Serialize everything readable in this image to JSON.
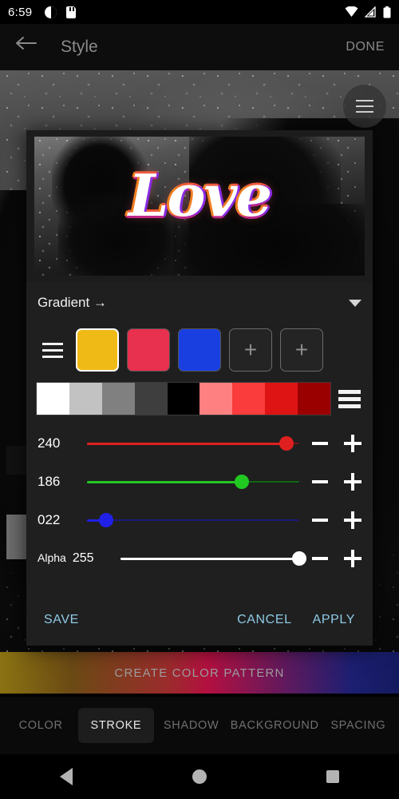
{
  "statusbar": {
    "time": "6:59",
    "icons_left": [
      "do-not-disturb-icon",
      "sd-card-icon"
    ],
    "icons_right": [
      "wifi-icon",
      "cellular-signal-icon",
      "battery-icon"
    ]
  },
  "appbar": {
    "back_icon": "back-arrow-icon",
    "title": "Style",
    "done_label": "DONE"
  },
  "background": {
    "fab_icon": "hamburger-menu-icon"
  },
  "dialog": {
    "preview": {
      "text": "Love"
    },
    "gradient": {
      "label": "Gradient →",
      "caret_icon": "chevron-down-icon"
    },
    "swatches": {
      "handle_icon": "drag-handle-icon",
      "colors": [
        "#F0BA16",
        "#E8304F",
        "#1A3FE0"
      ],
      "selected_index": 0,
      "add_label": "+",
      "add_count": 2
    },
    "palette": {
      "handle_icon": "palette-handle-icon",
      "colors": [
        "#FFFFFF",
        "#C2C2C2",
        "#808080",
        "#3E3E3E",
        "#000000",
        "#FF8080",
        "#FA3C3C",
        "#DE1414",
        "#9B0000"
      ]
    },
    "sliders": [
      {
        "name": "red",
        "value": "240",
        "percent": 94,
        "color": "#E02020",
        "track": "#7a1111",
        "has_label": false
      },
      {
        "name": "green",
        "value": "186",
        "percent": 73,
        "color": "#22C822",
        "track": "#116611",
        "has_label": false
      },
      {
        "name": "blue",
        "value": "022",
        "percent": 9,
        "color": "#2020E8",
        "track": "#1a1a7a",
        "has_label": false
      },
      {
        "name": "alpha",
        "label": "Alpha",
        "value": "255",
        "percent": 100,
        "color": "#FFFFFF",
        "track": "#FFFFFF",
        "has_label": true
      }
    ],
    "slider_buttons": {
      "minus": "minus-icon",
      "plus": "plus-icon"
    },
    "actions": {
      "save": "SAVE",
      "cancel": "CANCEL",
      "apply": "APPLY",
      "color": "#8ECAE6"
    }
  },
  "create_pattern": {
    "label": "CREATE COLOR PATTERN"
  },
  "tabs": {
    "items": [
      {
        "label": "COLOR",
        "active": false
      },
      {
        "label": "STROKE",
        "active": true
      },
      {
        "label": "SHADOW",
        "active": false
      },
      {
        "label": "BACKGROUND",
        "active": false
      },
      {
        "label": "SPACING",
        "active": false
      }
    ]
  },
  "navbar": {
    "back": "nav-back-icon",
    "home": "nav-home-icon",
    "recents": "nav-recents-icon"
  }
}
